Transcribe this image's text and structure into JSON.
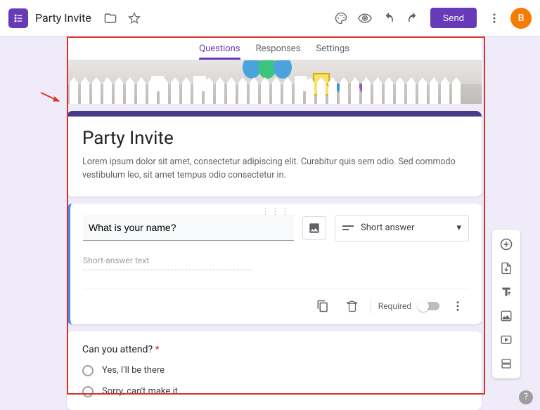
{
  "header": {
    "doc_title": "Party Invite",
    "send_label": "Send",
    "avatar_initial": "B"
  },
  "tabs": {
    "questions": "Questions",
    "responses": "Responses",
    "settings": "Settings",
    "active": "questions"
  },
  "form": {
    "title": "Party Invite",
    "description": "Lorem ipsum dolor sit amet, consectetur adipiscing elit. Curabitur quis sem odio. Sed commodo vestibulum leo, sit amet tempus odio consectetur in."
  },
  "question1": {
    "prompt": "What is your name?",
    "answer_placeholder": "Short-answer text",
    "type_label": "Short answer",
    "required_label": "Required"
  },
  "question2": {
    "prompt": "Can you attend?",
    "required": true,
    "options": [
      "Yes,  I'll be there",
      "Sorry, can't make it"
    ]
  },
  "colors": {
    "primary": "#673ab7",
    "accent": "#4285f4"
  }
}
